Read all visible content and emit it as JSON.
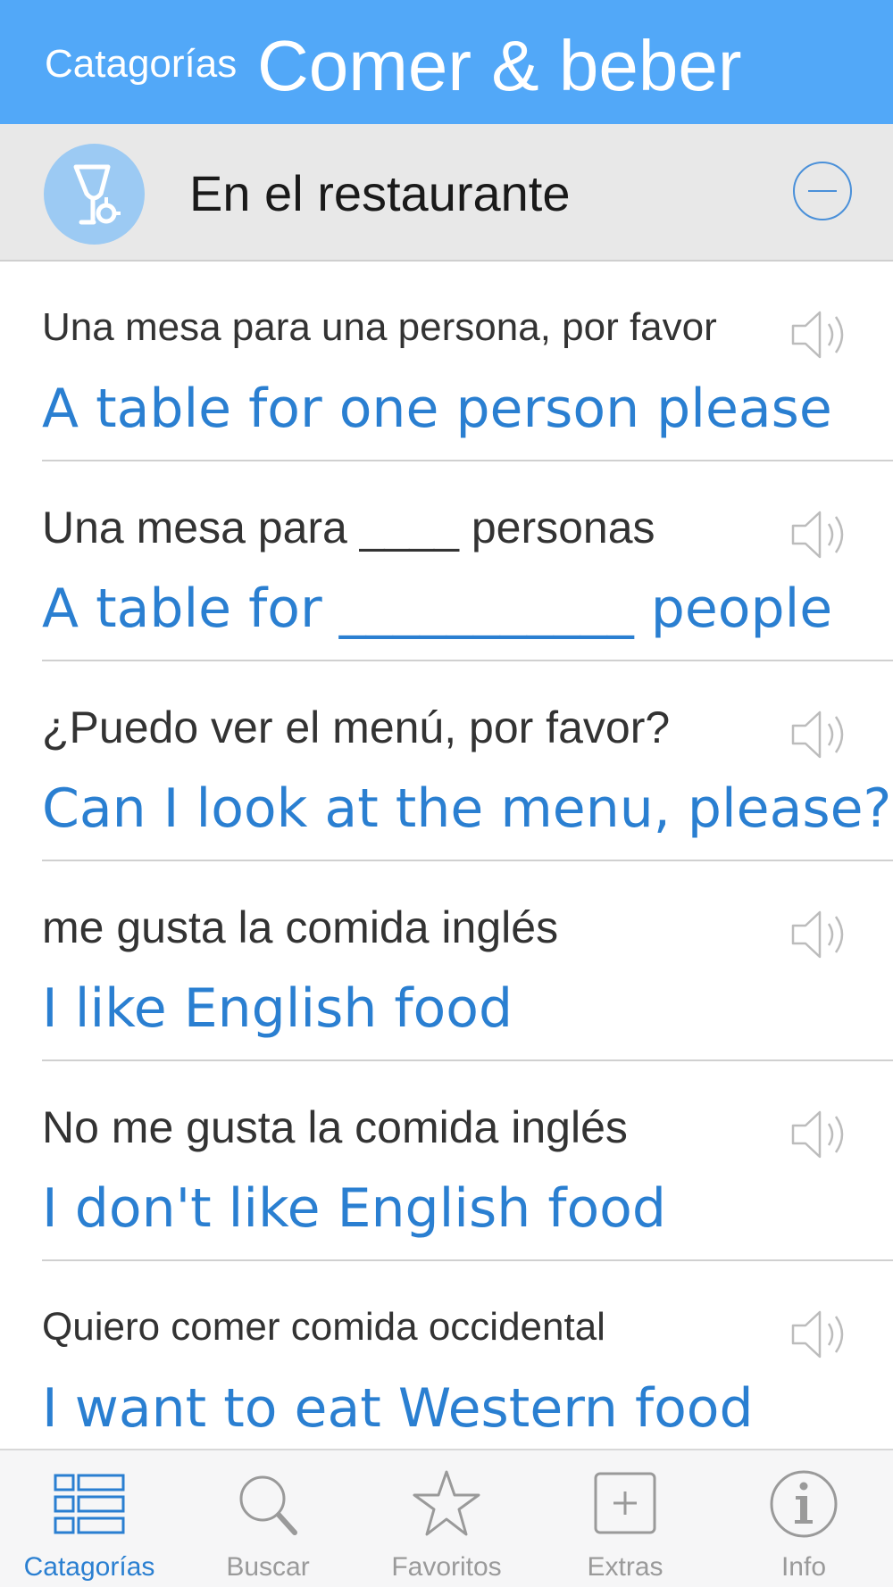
{
  "navbar": {
    "back_label": "Catagorías",
    "title": "Comer & beber"
  },
  "section": {
    "title": "En el restaurante",
    "icon": "wine-glass-icon",
    "action_icon": "minus-circle-icon"
  },
  "phrases": [
    {
      "native": "Una mesa para una persona, por favor",
      "foreign": "A table for one person please"
    },
    {
      "native": "Una mesa para ____ personas",
      "foreign": "A table for ___________ people"
    },
    {
      "native": "¿Puedo ver el menú, por favor?",
      "foreign": "Can I look at the menu, please?"
    },
    {
      "native": "me gusta la comida inglés",
      "foreign": "I like English food"
    },
    {
      "native": "No me gusta la comida inglés",
      "foreign": "I don't like English food"
    },
    {
      "native": "Quiero comer comida occidental",
      "foreign": "I want to eat Western food"
    }
  ],
  "tabs": [
    {
      "label": "Catagorías",
      "icon": "list-icon",
      "active": true
    },
    {
      "label": "Buscar",
      "icon": "search-icon",
      "active": false
    },
    {
      "label": "Favoritos",
      "icon": "star-icon",
      "active": false
    },
    {
      "label": "Extras",
      "icon": "plus-square-icon",
      "active": false
    },
    {
      "label": "Info",
      "icon": "info-icon",
      "active": false
    }
  ],
  "colors": {
    "navbar": "#52a8f8",
    "accent": "#2a7fd1",
    "section_bg": "#e8e8e8",
    "inactive_tab": "#9a9a9a"
  }
}
